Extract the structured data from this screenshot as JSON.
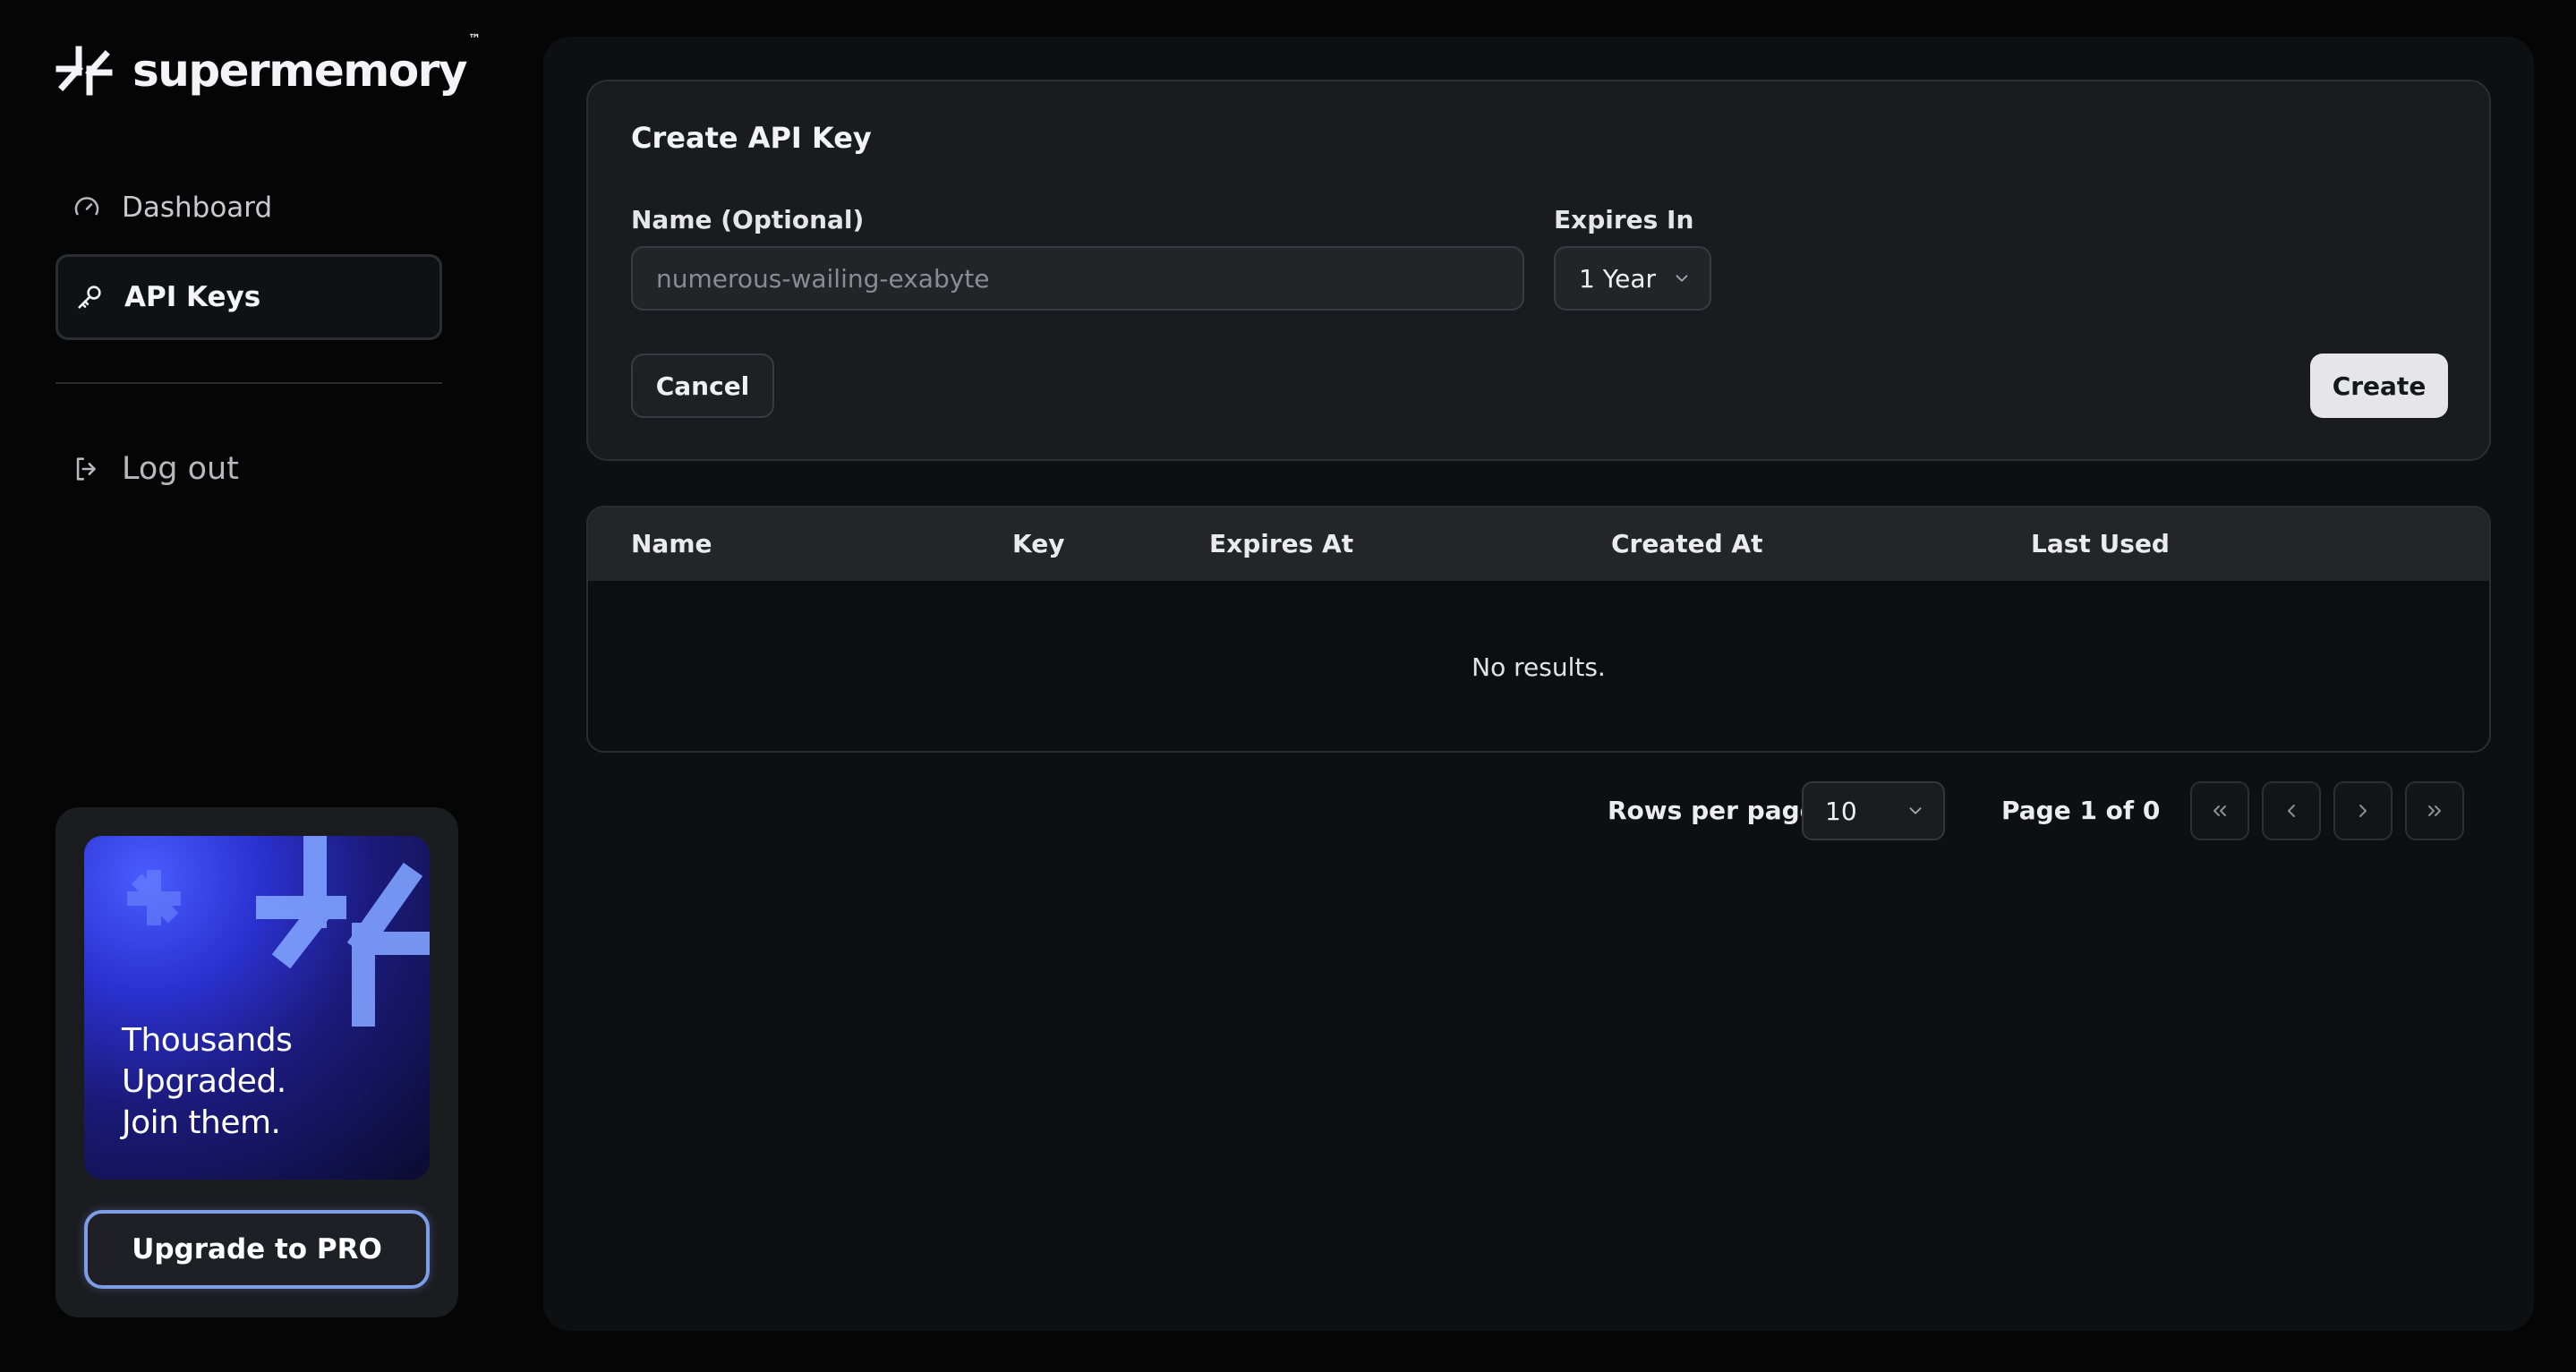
{
  "app": {
    "name": "supermemory",
    "trademark": "™"
  },
  "sidebar": {
    "items": [
      {
        "label": "Dashboard",
        "icon": "gauge-icon"
      },
      {
        "label": "API Keys",
        "icon": "key-icon",
        "active": true
      }
    ],
    "logout": {
      "label": "Log out",
      "icon": "logout-icon"
    },
    "promo": {
      "text_lines": [
        "Thousands",
        "Upgraded.",
        "Join them."
      ],
      "button_label": "Upgrade to PRO"
    }
  },
  "create_card": {
    "title": "Create API Key",
    "name_label": "Name (Optional)",
    "name_placeholder": "numerous-wailing-exabyte",
    "name_value": "",
    "expires_label": "Expires In",
    "expires_value": "1 Year",
    "cancel_label": "Cancel",
    "create_label": "Create"
  },
  "table": {
    "columns": [
      "Name",
      "Key",
      "Expires At",
      "Created At",
      "Last Used"
    ],
    "rows": [],
    "empty_text": "No results."
  },
  "pagination": {
    "rows_per_page_label": "Rows per page",
    "rows_per_page_value": "10",
    "page_info": "Page 1 of 0"
  },
  "colors": {
    "background": "#050506",
    "panel": "#0e0f11",
    "card": "#1a1b1e",
    "accent_border": "#7d9ee6",
    "promo_gradient": "#2a31cf"
  }
}
